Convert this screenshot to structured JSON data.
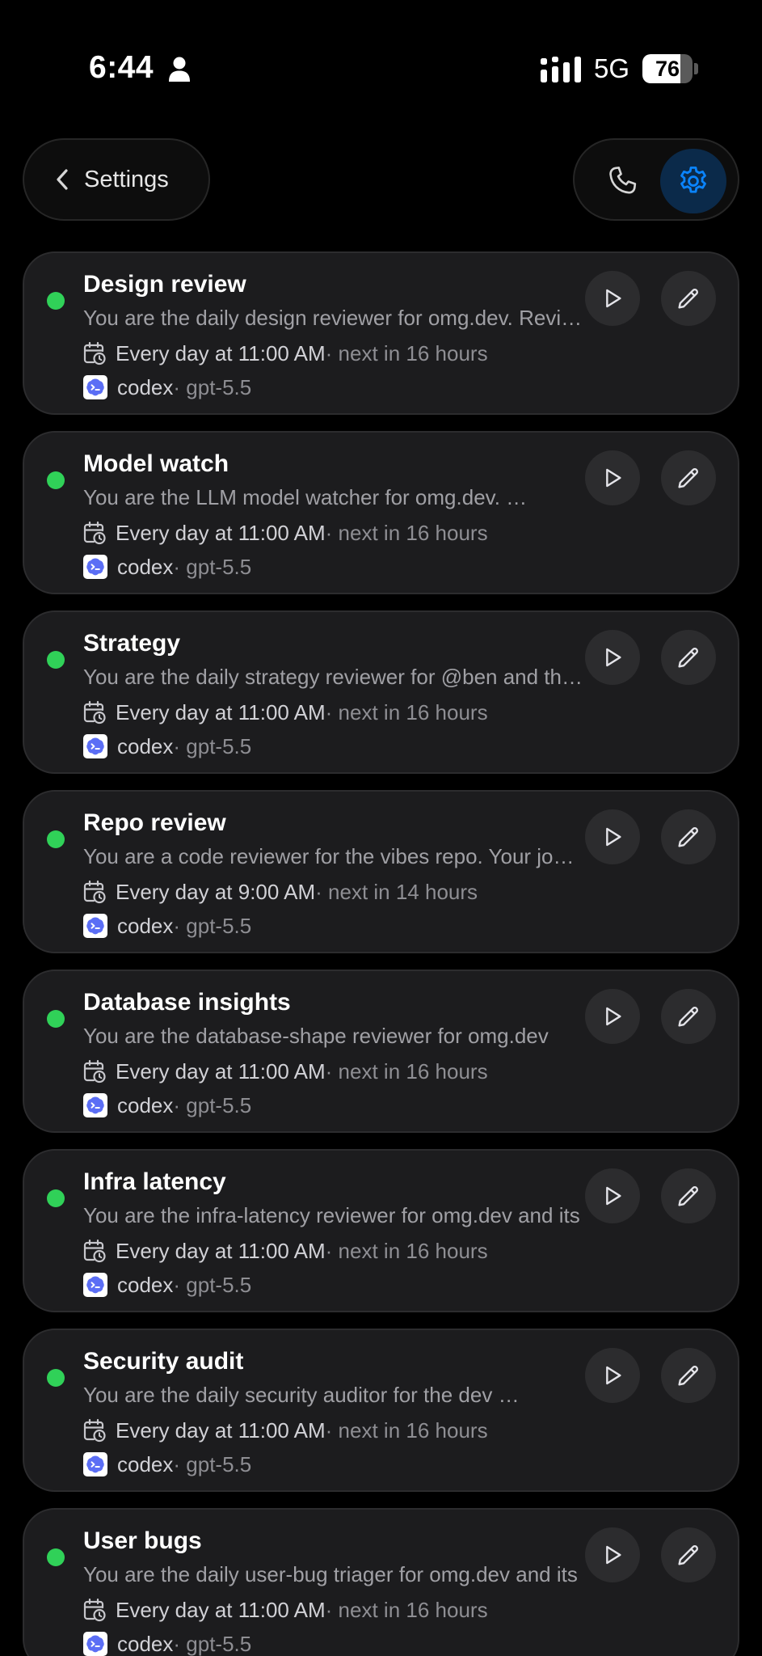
{
  "status_bar": {
    "time": "6:44",
    "network": "5G",
    "battery_level": "76",
    "battery_fraction": 0.76
  },
  "nav": {
    "back_label": "Settings",
    "icons": [
      "chevron-left-icon",
      "phone-icon",
      "gear-icon"
    ]
  },
  "colors": {
    "active_dot": "#30d158",
    "accent": "#0a84ff",
    "card_bg": "#1c1c1e"
  },
  "tasks": [
    {
      "title": "Design review",
      "description": "You are the daily design reviewer for omg.dev. Review the design",
      "schedule": "Every day at 11:00 AM",
      "next": "· next in 16 hours",
      "agent": "codex",
      "model": "· gpt-5.5"
    },
    {
      "title": "Model watch",
      "description": "You are the LLM model watcher for omg.dev. …",
      "schedule": "Every day at 11:00 AM",
      "next": "· next in 16 hours",
      "agent": "codex",
      "model": "· gpt-5.5"
    },
    {
      "title": "Strategy",
      "description": "You are the daily strategy reviewer for @ben and the team",
      "schedule": "Every day at 11:00 AM",
      "next": "· next in 16 hours",
      "agent": "codex",
      "model": "· gpt-5.5"
    },
    {
      "title": "Repo review",
      "description": "You are a code reviewer for the vibes repo. Your job is",
      "schedule": "Every day at 9:00 AM",
      "next": "· next in 14 hours",
      "agent": "codex",
      "model": "· gpt-5.5"
    },
    {
      "title": "Database insights",
      "description": "You are the database-shape reviewer for omg.dev",
      "schedule": "Every day at 11:00 AM",
      "next": "· next in 16 hours",
      "agent": "codex",
      "model": "· gpt-5.5"
    },
    {
      "title": "Infra latency",
      "description": "You are the infra-latency reviewer for omg.dev and its",
      "schedule": "Every day at 11:00 AM",
      "next": "· next in 16 hours",
      "agent": "codex",
      "model": "· gpt-5.5"
    },
    {
      "title": "Security audit",
      "description": "You are the daily security auditor for the dev …",
      "schedule": "Every day at 11:00 AM",
      "next": "· next in 16 hours",
      "agent": "codex",
      "model": "· gpt-5.5"
    },
    {
      "title": "User bugs",
      "description": "You are the daily user-bug triager for omg.dev and its",
      "schedule": "Every day at 11:00 AM",
      "next": "· next in 16 hours",
      "agent": "codex",
      "model": "· gpt-5.5"
    }
  ]
}
